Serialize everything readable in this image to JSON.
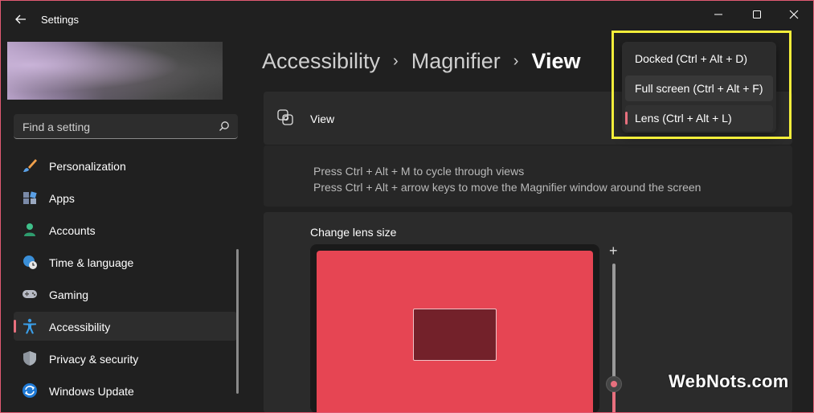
{
  "window": {
    "title": "Settings",
    "accent_color": "#e8707e"
  },
  "search": {
    "placeholder": "Find a setting"
  },
  "sidebar": {
    "items": [
      {
        "label": "Personalization",
        "icon": "brush-icon"
      },
      {
        "label": "Apps",
        "icon": "apps-icon"
      },
      {
        "label": "Accounts",
        "icon": "person-icon"
      },
      {
        "label": "Time & language",
        "icon": "globe-clock-icon"
      },
      {
        "label": "Gaming",
        "icon": "gamepad-icon"
      },
      {
        "label": "Accessibility",
        "icon": "accessibility-icon",
        "selected": true
      },
      {
        "label": "Privacy & security",
        "icon": "shield-icon"
      },
      {
        "label": "Windows Update",
        "icon": "update-icon"
      }
    ]
  },
  "breadcrumb": {
    "items": [
      "Accessibility",
      "Magnifier",
      "View"
    ]
  },
  "view_setting": {
    "label": "View",
    "icon": "magnifier-view-icon",
    "help_lines": [
      "Press Ctrl + Alt + M to cycle through views",
      "Press Ctrl + Alt + arrow keys to move the Magnifier window around the screen"
    ]
  },
  "view_dropdown": {
    "options": [
      "Docked (Ctrl + Alt + D)",
      "Full screen (Ctrl + Alt + F)",
      "Lens (Ctrl + Alt + L)"
    ],
    "selected": "Lens (Ctrl + Alt + L)"
  },
  "lens_size": {
    "title": "Change lens size",
    "slider_plus": "+"
  },
  "watermark": "WebNots.com"
}
